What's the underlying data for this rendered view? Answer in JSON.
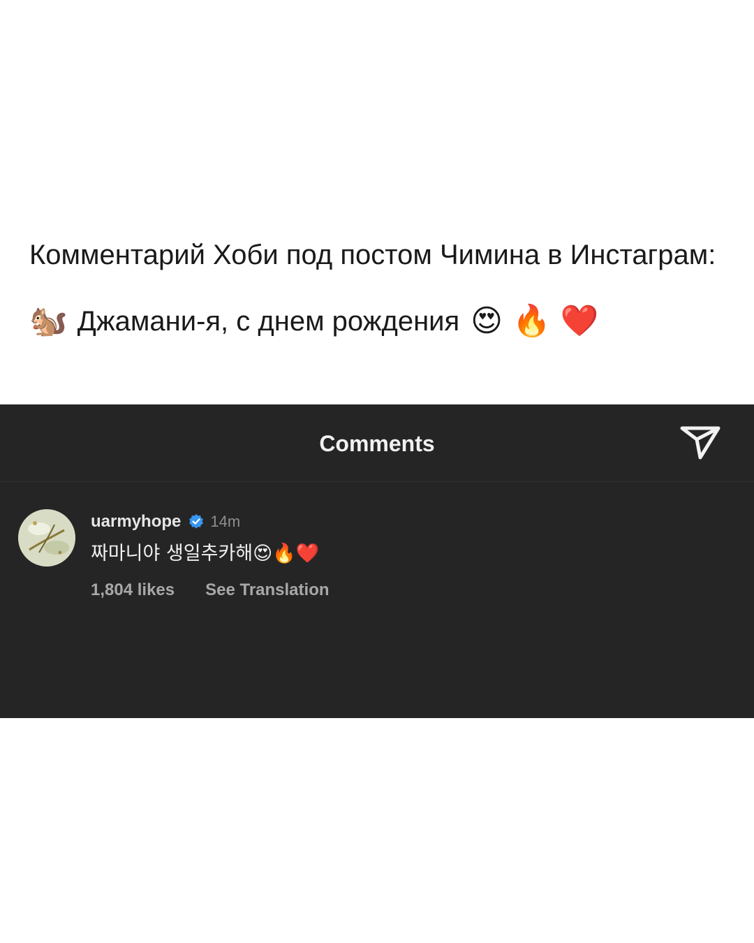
{
  "caption": {
    "title": "Комментарий Хоби под постом Чимина в Инстаграм:",
    "quote_emoji_start": "🐿️",
    "quote_text": "Джамани-я, с днем рождения",
    "quote_emoji_1": "😍",
    "quote_emoji_2": "🔥",
    "quote_emoji_3": "❤️"
  },
  "panel": {
    "title": "Comments",
    "share_icon": "paper-plane-icon",
    "background_color": "#252526"
  },
  "comment": {
    "username": "uarmyhope",
    "verified_icon": "verified-badge-icon",
    "verified_color": "#3897f0",
    "time": "14m",
    "text": "짜마니야 생일추카해😍🔥❤️",
    "likes": "1,804 likes",
    "translate_label": "See Translation"
  }
}
